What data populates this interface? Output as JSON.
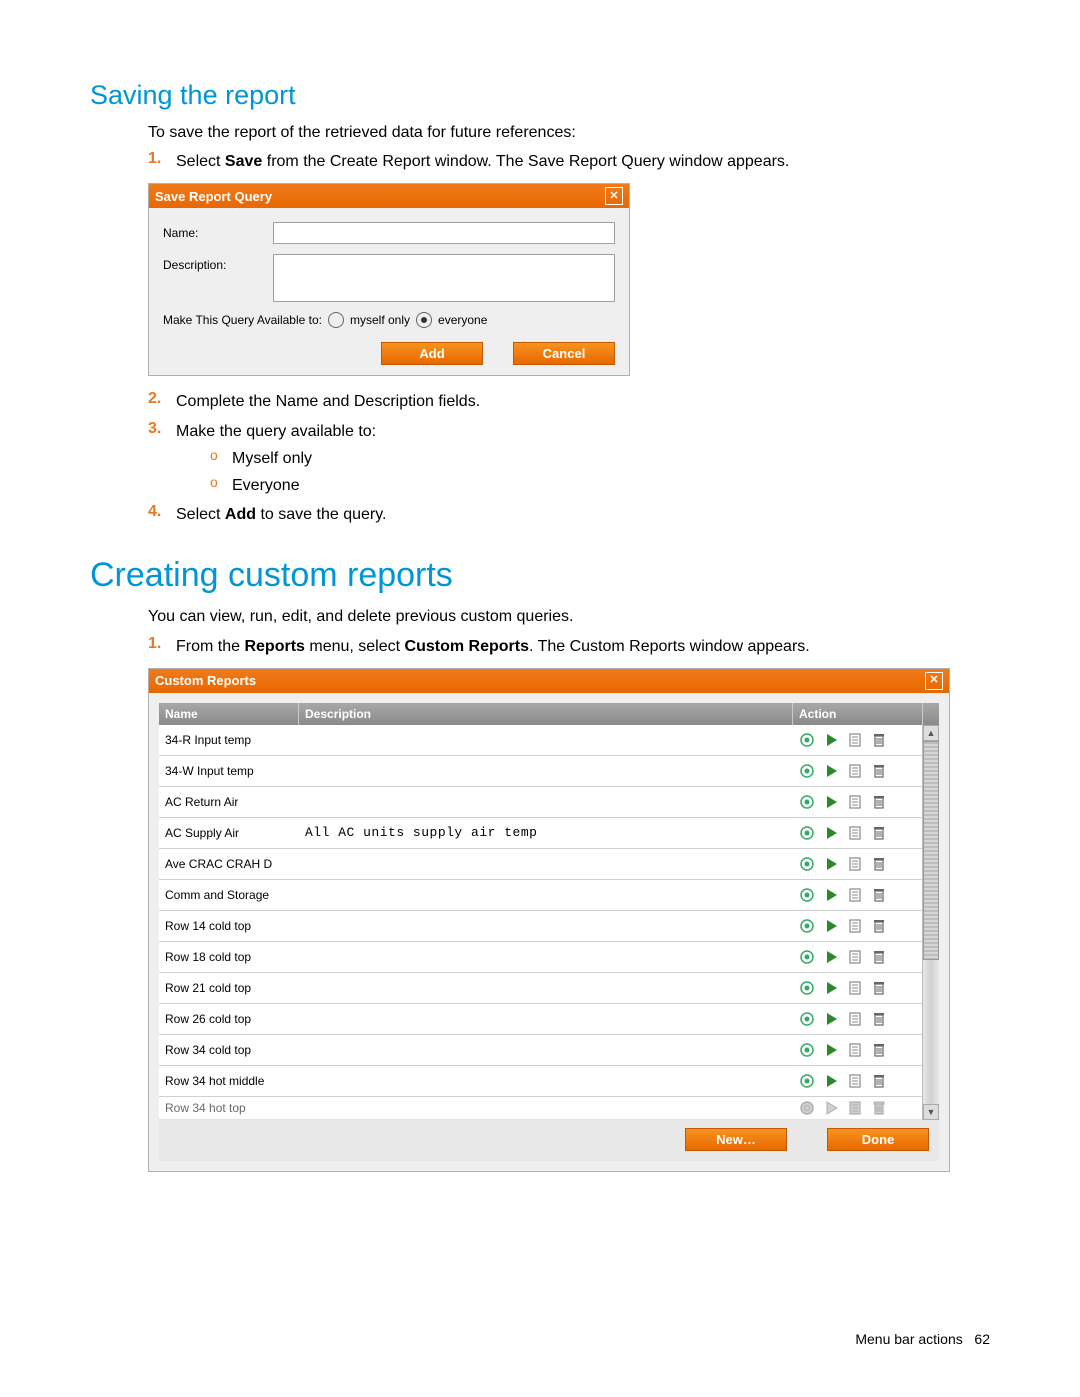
{
  "section1": {
    "title": "Saving the report",
    "intro": "To save the report of the retrieved data for future references:",
    "steps": {
      "s1_pre": "Select ",
      "s1_bold": "Save",
      "s1_post": " from the Create Report window. The Save Report Query window appears.",
      "s2": "Complete the Name and Description fields.",
      "s3": "Make the query available to:",
      "s3a": "Myself only",
      "s3b": "Everyone",
      "s4_pre": "Select ",
      "s4_bold": "Add",
      "s4_post": " to save the query."
    }
  },
  "save_dialog": {
    "title": "Save Report Query",
    "name_label": "Name:",
    "desc_label": "Description:",
    "avail_label": "Make This Query Available to:",
    "opt_myself": "myself only",
    "opt_everyone": "everyone",
    "add_btn": "Add",
    "cancel_btn": "Cancel"
  },
  "section2": {
    "title": "Creating custom reports",
    "intro": "You can view, run, edit, and delete previous custom queries.",
    "s1_a": "From the ",
    "s1_b1": "Reports",
    "s1_b": " menu, select ",
    "s1_b2": "Custom Reports",
    "s1_c": ". The Custom Reports window appears."
  },
  "custom_dialog": {
    "title": "Custom Reports",
    "col_name": "Name",
    "col_desc": "Description",
    "col_action": "Action",
    "rows": [
      {
        "name": "34-R Input temp",
        "desc": ""
      },
      {
        "name": "34-W Input temp",
        "desc": ""
      },
      {
        "name": "AC Return Air",
        "desc": ""
      },
      {
        "name": "AC Supply Air",
        "desc": "All AC units supply air temp"
      },
      {
        "name": "Ave CRAC CRAH D",
        "desc": ""
      },
      {
        "name": "Comm and Storage",
        "desc": ""
      },
      {
        "name": "Row 14 cold top",
        "desc": ""
      },
      {
        "name": "Row 18 cold top",
        "desc": ""
      },
      {
        "name": "Row 21 cold top",
        "desc": ""
      },
      {
        "name": "Row 26 cold top",
        "desc": ""
      },
      {
        "name": "Row 34 cold top",
        "desc": ""
      },
      {
        "name": "Row 34 hot middle",
        "desc": ""
      }
    ],
    "partial_row": {
      "name": "Row 34 hot top",
      "desc": ""
    },
    "new_btn": "New…",
    "done_btn": "Done"
  },
  "footer": {
    "section": "Menu bar actions",
    "page": "62"
  },
  "numbers": {
    "n1": "1.",
    "n2": "2.",
    "n3": "3.",
    "n4": "4.",
    "circ": "o"
  }
}
